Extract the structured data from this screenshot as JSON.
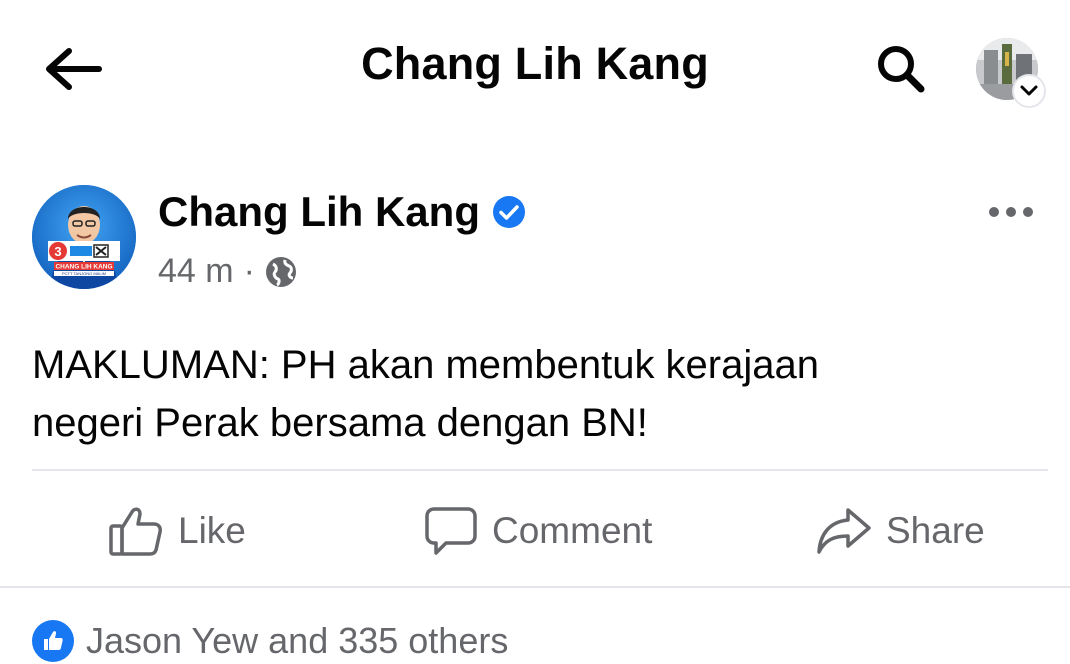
{
  "header": {
    "title": "Chang Lih Kang",
    "back_icon": "arrow-left-icon",
    "search_icon": "search-icon",
    "account_icon": "account-avatar",
    "chevron_icon": "chevron-down-icon"
  },
  "post": {
    "author": "Chang Lih Kang",
    "verified_icon": "verified-badge-icon",
    "time": "44 m",
    "separator": "·",
    "privacy_icon": "globe-icon",
    "more_icon": "more-horizontal-icon",
    "text_line1": "MAKLUMAN: PH akan membentuk kerajaan",
    "text_line2": "negeri Perak bersama dengan BN!",
    "avatar_ballot_number": "3",
    "avatar_name_banner": "CHANG LIH KANG",
    "avatar_sub_banner": "PCTT TANJONG MALIM"
  },
  "actions": {
    "like": "Like",
    "comment": "Comment",
    "share": "Share"
  },
  "reactions": {
    "summary": "Jason Yew and 335 others",
    "icon": "like-reaction-icon"
  },
  "colors": {
    "brand_blue": "#1877f2",
    "secondary_text": "#65676b",
    "divider": "#e4e6eb",
    "primary_text": "#050505"
  }
}
